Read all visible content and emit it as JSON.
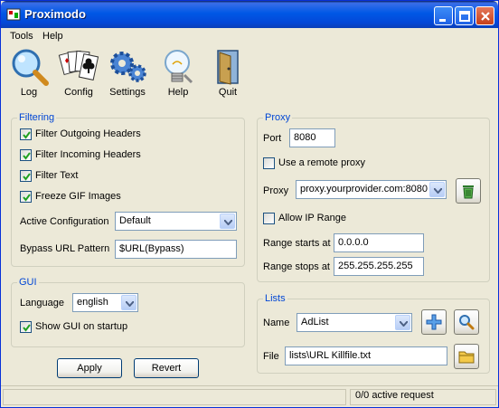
{
  "window": {
    "title": "Proximodo"
  },
  "menu": {
    "tools": "Tools",
    "help": "Help"
  },
  "toolbar": {
    "log": "Log",
    "config": "Config",
    "settings": "Settings",
    "help": "Help",
    "quit": "Quit"
  },
  "filtering": {
    "legend": "Filtering",
    "filter_outgoing": "Filter Outgoing Headers",
    "filter_incoming": "Filter Incoming Headers",
    "filter_text": "Filter Text",
    "freeze_gif": "Freeze GIF Images",
    "active_config_label": "Active Configuration",
    "active_config_value": "Default",
    "bypass_label": "Bypass URL Pattern",
    "bypass_value": "$URL(Bypass)"
  },
  "gui": {
    "legend": "GUI",
    "language_label": "Language",
    "language_value": "english",
    "show_on_startup": "Show GUI on startup"
  },
  "proxy": {
    "legend": "Proxy",
    "port_label": "Port",
    "port_value": "8080",
    "use_remote": "Use a remote proxy",
    "proxy_label": "Proxy",
    "proxy_value": "proxy.yourprovider.com:8080",
    "allow_ip_range": "Allow IP Range",
    "range_start_label": "Range starts at",
    "range_start_value": "0.0.0.0",
    "range_stop_label": "Range stops at",
    "range_stop_value": "255.255.255.255"
  },
  "lists": {
    "legend": "Lists",
    "name_label": "Name",
    "name_value": "AdList",
    "file_label": "File",
    "file_value": "lists\\URL Killfile.txt"
  },
  "buttons": {
    "apply": "Apply",
    "revert": "Revert"
  },
  "status": {
    "requests": "0/0 active request"
  },
  "state": {
    "filter_outgoing": true,
    "filter_incoming": true,
    "filter_text": true,
    "freeze_gif": true,
    "show_on_startup": true,
    "use_remote": false,
    "allow_ip_range": false
  },
  "icons": {
    "log": "magnifier-icon",
    "config": "playing-cards-icon",
    "settings": "gears-icon",
    "help": "lightbulb-icon",
    "quit": "door-icon",
    "delete": "trash-can-icon",
    "add": "plus-icon",
    "search": "magnifier-icon",
    "browse": "folder-icon"
  }
}
